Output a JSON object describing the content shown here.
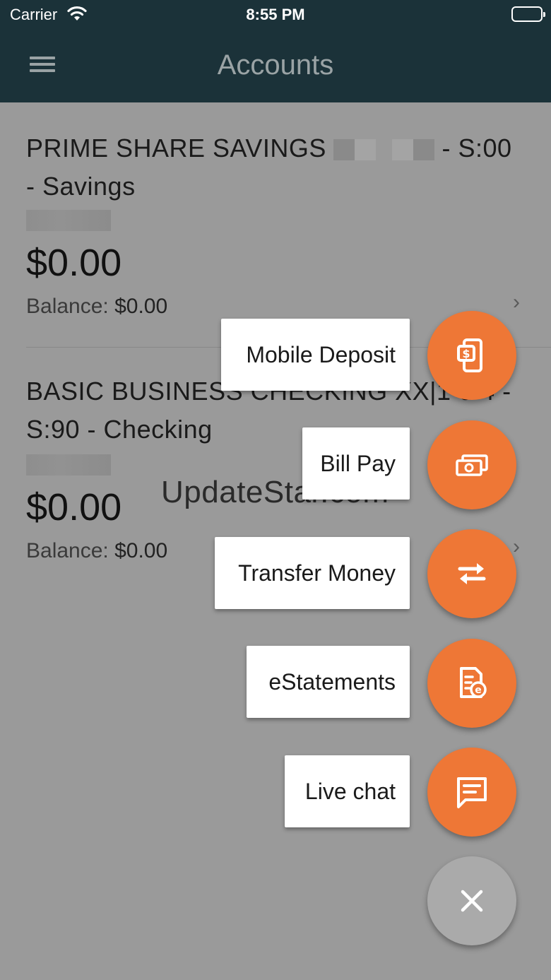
{
  "status_bar": {
    "carrier": "Carrier",
    "time": "8:55 PM"
  },
  "header": {
    "title": "Accounts"
  },
  "accounts": [
    {
      "name_prefix": "PRIME SHARE SAVINGS",
      "name_suffix": "- S:00",
      "name_line2": "- Savings",
      "amount": "$0.00",
      "balance_label": "Balance:",
      "balance_value": "$0.00"
    },
    {
      "name_line1": "BASIC BUSINESS CHECKING XX|1 0 4 -",
      "name_line2": "S:90 - Checking",
      "amount": "$0.00",
      "balance_label": "Balance:",
      "balance_value": "$0.00"
    }
  ],
  "watermark": "UpdateStar.com",
  "fab_menu": {
    "items": [
      {
        "label": "Mobile Deposit",
        "icon": "mobile-deposit-icon"
      },
      {
        "label": "Bill Pay",
        "icon": "bill-pay-icon"
      },
      {
        "label": "Transfer Money",
        "icon": "transfer-icon"
      },
      {
        "label": "eStatements",
        "icon": "estatement-icon"
      },
      {
        "label": "Live chat",
        "icon": "chat-icon"
      }
    ],
    "close_icon": "close-icon",
    "accent_color": "#ee7736",
    "close_color": "#aaaaaa"
  },
  "colors": {
    "header_bg": "#1b3239",
    "overlay_bg": "#9a9a9a"
  }
}
